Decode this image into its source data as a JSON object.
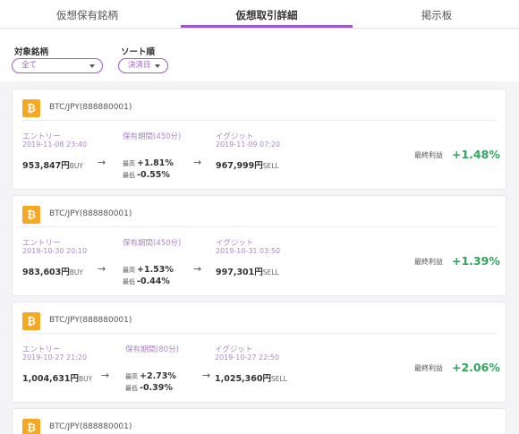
{
  "tabs": [
    {
      "label": "仮想保有銘柄"
    },
    {
      "label": "仮想取引詳細"
    },
    {
      "label": "掲示板"
    }
  ],
  "filters": {
    "target_label": "対象銘柄",
    "target_value": "全て",
    "sort_label": "ソート順",
    "sort_value": "決済日"
  },
  "colors": {
    "accent": "#9b59d0",
    "profit": "#2fa55a",
    "coin": "#f7a823"
  },
  "icons": {
    "coin": "bitcoin-icon",
    "arrow": "arrow-right-icon",
    "caret": "caret-down-icon"
  },
  "trades": [
    {
      "pair": "BTC/JPY(888880001)",
      "entry_label": "エントリー",
      "entry_date": "2019-11-08 23:40",
      "entry_price": "953,847円",
      "entry_side": "BUY",
      "holding_label": "保有期間(450分)",
      "high_key": "最高",
      "high_value": "+1.81%",
      "low_key": "最低",
      "low_value": "-0.55%",
      "exit_label": "イグジット",
      "exit_date": "2019-11-09 07:20",
      "exit_price": "967,999円",
      "exit_side": "SELL",
      "pl_label": "最終利益",
      "pl_value": "+1.48%"
    },
    {
      "pair": "BTC/JPY(888880001)",
      "entry_label": "エントリー",
      "entry_date": "2019-10-30 20:10",
      "entry_price": "983,603円",
      "entry_side": "BUY",
      "holding_label": "保有期間(450分)",
      "high_key": "最高",
      "high_value": "+1.53%",
      "low_key": "最低",
      "low_value": "-0.44%",
      "exit_label": "イグジット",
      "exit_date": "2019-10-31 03:50",
      "exit_price": "997,301円",
      "exit_side": "SELL",
      "pl_label": "最終利益",
      "pl_value": "+1.39%"
    },
    {
      "pair": "BTC/JPY(888880001)",
      "entry_label": "エントリー",
      "entry_date": "2019-10-27 21:20",
      "entry_price": "1,004,631円",
      "entry_side": "BUY",
      "holding_label": "保有期間(80分)",
      "high_key": "最高",
      "high_value": "+2.73%",
      "low_key": "最低",
      "low_value": "-0.39%",
      "exit_label": "イグジット",
      "exit_date": "2019-10-27 22:50",
      "exit_price": "1,025,360円",
      "exit_side": "SELL",
      "pl_label": "最終利益",
      "pl_value": "+2.06%"
    },
    {
      "pair": "BTC/JPY(888880001)"
    }
  ]
}
